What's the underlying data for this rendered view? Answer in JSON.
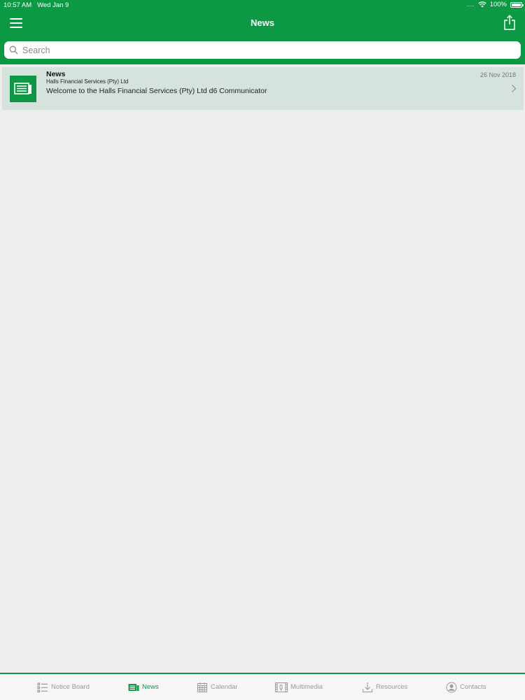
{
  "status_bar": {
    "time": "10:57 AM",
    "date": "Wed Jan 9",
    "signal": ".....",
    "battery": "100%"
  },
  "nav": {
    "title": "News",
    "menu_icon": "hamburger-menu-icon",
    "share_icon": "share-icon"
  },
  "search": {
    "placeholder": "Search",
    "value": ""
  },
  "news_items": [
    {
      "category": "News",
      "organization": "Halls Financial Services (Pty) Ltd",
      "headline": "Welcome to the Halls Financial Services (Pty) Ltd d6 Communicator",
      "date": "26 Nov 2018",
      "icon": "newspaper-icon"
    }
  ],
  "tabs": [
    {
      "label": "Notice Board",
      "icon": "list-icon",
      "active": false
    },
    {
      "label": "News",
      "icon": "newspaper-icon",
      "active": true
    },
    {
      "label": "Calendar",
      "icon": "calendar-icon",
      "active": false
    },
    {
      "label": "Multimedia",
      "icon": "multimedia-icon",
      "active": false
    },
    {
      "label": "Resources",
      "icon": "download-icon",
      "active": false
    },
    {
      "label": "Contacts",
      "icon": "contact-icon",
      "active": false
    }
  ],
  "colors": {
    "brand": "#0b9a43",
    "background": "#ededee",
    "item_highlight": "#d5e3dc",
    "tab_inactive": "#9a9a9e"
  }
}
